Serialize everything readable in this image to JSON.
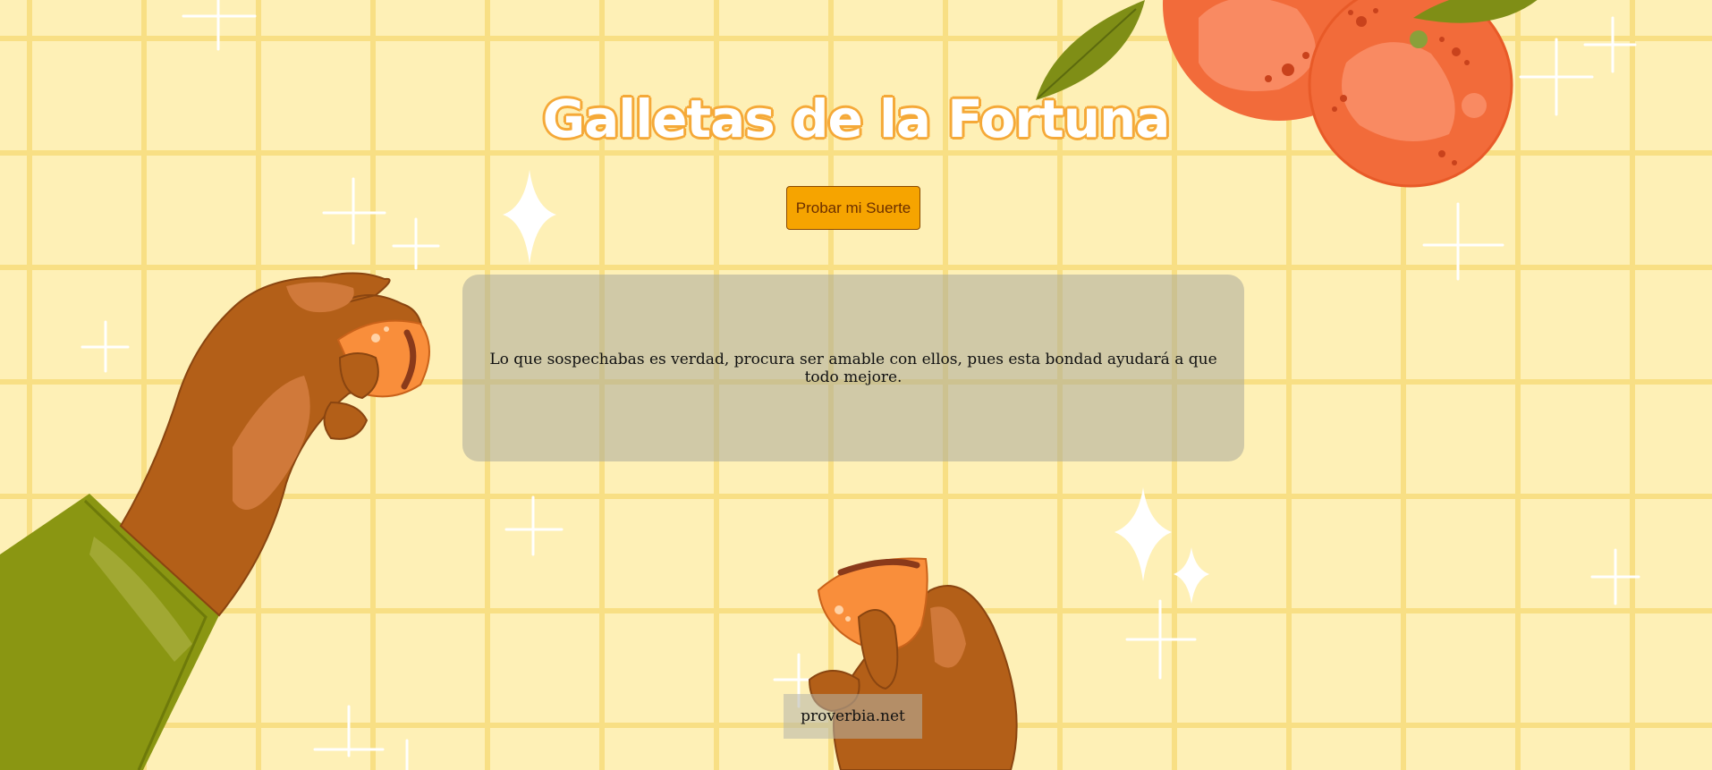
{
  "page": {
    "title": "Galletas de la Fortuna"
  },
  "actions": {
    "try_luck_label": "Probar mi Suerte"
  },
  "fortune": {
    "message": "Lo que sospechabas es verdad, procura ser amable con ellos, pues esta bondad ayudará a que todo mejore."
  },
  "footer": {
    "link_text": "proverbia.net"
  },
  "colors": {
    "background": "#fef0b6",
    "grid_lines": "#f8df84",
    "title_outline": "#f5a938",
    "button_bg": "#f6a400",
    "button_text": "#6b2f00",
    "orange_fruit": "#f26b3a",
    "leaf": "#7f8e16",
    "skin": "#b35f18",
    "sleeve": "#8a9612",
    "cookie": "#f98e3b"
  },
  "icons": [
    "sparkle-icon",
    "orange-fruit-illustration",
    "hand-with-cookie-illustration"
  ]
}
